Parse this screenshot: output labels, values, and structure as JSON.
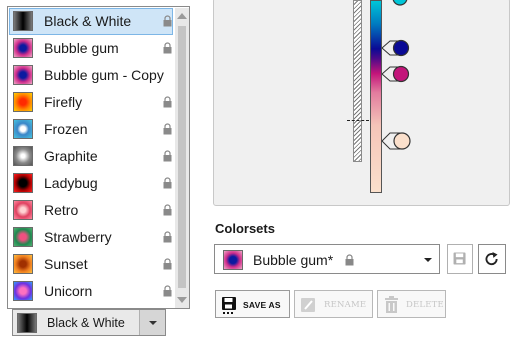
{
  "colormap_list": {
    "items": [
      {
        "label": "Black & White",
        "locked": true,
        "selected": true,
        "gradient": "linear-gradient(90deg,#7a7a7a,#000 50%,#7a7a7a)"
      },
      {
        "label": "Bubble gum",
        "locked": true,
        "selected": false,
        "gradient": "radial-gradient(circle,#0b1aa0 0 25%,#cf2c8b 55%,#f0a8c6 100%)"
      },
      {
        "label": "Bubble gum - Copy",
        "locked": false,
        "selected": false,
        "gradient": "radial-gradient(circle,#0b1aa0 0 25%,#cf2c8b 55%,#f0a8c6 100%)"
      },
      {
        "label": "Firefly",
        "locked": true,
        "selected": false,
        "gradient": "radial-gradient(circle,#ff2a00 0 25%,#ff8a00 60%,#ffd000 100%)"
      },
      {
        "label": "Frozen",
        "locked": true,
        "selected": false,
        "gradient": "radial-gradient(circle,#ffffff 0 20%,#3a86c8 45%,#47c4e0 100%)"
      },
      {
        "label": "Graphite",
        "locked": true,
        "selected": false,
        "gradient": "radial-gradient(circle,#ffffff 0 15%,#8a8a8a 55%,#555 100%)"
      },
      {
        "label": "Ladybug",
        "locked": true,
        "selected": false,
        "gradient": "radial-gradient(circle,#000 0 30%,#b00000 60%,#ff2020 100%)"
      },
      {
        "label": "Retro",
        "locked": true,
        "selected": false,
        "gradient": "radial-gradient(circle,#ffd2d2 0 20%,#e04060 55%,#ff8aa0 100%)"
      },
      {
        "label": "Strawberry",
        "locked": true,
        "selected": false,
        "gradient": "radial-gradient(circle,#f05080 0 25%,#208850 60%,#50b070 100%)"
      },
      {
        "label": "Sunset",
        "locked": true,
        "selected": false,
        "gradient": "radial-gradient(circle,#a03000 0 25%,#f08020 60%,#ffc040 100%)"
      },
      {
        "label": "Unicorn",
        "locked": true,
        "selected": false,
        "gradient": "radial-gradient(circle,#ff70c0 0 25%,#7030e0 60%,#30a0ff 100%)"
      }
    ]
  },
  "bottom_combo": {
    "label": "Black & White"
  },
  "editor": {
    "colorsets_label": "Colorsets",
    "current_colorset": "Bubble gum*",
    "buttons": {
      "save_as": "SAVE AS",
      "rename": "RENAME",
      "delete": "DELETE"
    },
    "handle_colors": [
      "#00c6d8",
      "#0a0a95",
      "#c3157a",
      "#fbe0cc"
    ]
  },
  "colors": {
    "selection_bg": "#cfe5f7",
    "selection_border": "#7db6e6"
  }
}
